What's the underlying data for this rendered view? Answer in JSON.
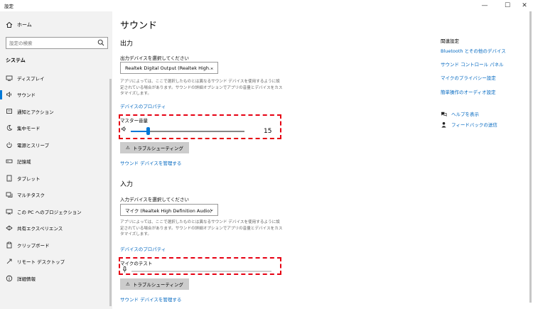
{
  "window": {
    "title": "設定",
    "minimize": "—",
    "maximize": "☐",
    "close": "✕"
  },
  "sidebar": {
    "home": "ホーム",
    "search_placeholder": "設定の検索",
    "section": "システム",
    "items": [
      {
        "label": "ディスプレイ",
        "icon": "display-icon",
        "active": false
      },
      {
        "label": "サウンド",
        "icon": "speaker-icon",
        "active": true
      },
      {
        "label": "通知とアクション",
        "icon": "notification-icon",
        "active": false
      },
      {
        "label": "集中モード",
        "icon": "moon-icon",
        "active": false
      },
      {
        "label": "電源とスリープ",
        "icon": "power-icon",
        "active": false
      },
      {
        "label": "記憶域",
        "icon": "storage-icon",
        "active": false
      },
      {
        "label": "タブレット",
        "icon": "tablet-icon",
        "active": false
      },
      {
        "label": "マルチタスク",
        "icon": "multitask-icon",
        "active": false
      },
      {
        "label": "この PC へのプロジェクション",
        "icon": "projection-icon",
        "active": false
      },
      {
        "label": "共有エクスペリエンス",
        "icon": "shared-icon",
        "active": false
      },
      {
        "label": "クリップボード",
        "icon": "clipboard-icon",
        "active": false
      },
      {
        "label": "リモート デスクトップ",
        "icon": "remote-icon",
        "active": false
      },
      {
        "label": "詳細情報",
        "icon": "info-icon",
        "active": false
      }
    ]
  },
  "main": {
    "title": "サウンド",
    "output": {
      "heading": "出力",
      "select_label": "出力デバイスを選択してください",
      "device": "Realtek Digital Output (Realtek High...",
      "desc": "アプリによっては、ここで選択したものとは異なるサウンド デバイスを使用するように設定されている場合があります。サウンドの詳細オプションでアプリの音量とデバイスをカスタマイズします。",
      "properties_link": "デバイスのプロパティ",
      "master_label": "マスター音量",
      "volume": 15,
      "volume_text": "15",
      "troubleshoot": "トラブルシューティング",
      "manage_link": "サウンド デバイスを管理する"
    },
    "input": {
      "heading": "入力",
      "select_label": "入力デバイスを選択してください",
      "device": "マイク (Realtek High Definition Audio)",
      "desc": "アプリによっては、ここで選択したものとは異なるサウンド デバイスを使用するように設定されている場合があります。サウンドの詳細オプションでアプリの音量とデバイスをカスタマイズします。",
      "properties_link": "デバイスのプロパティ",
      "mic_test_label": "マイクのテスト",
      "troubleshoot": "トラブルシューティング",
      "manage_link": "サウンド デバイスを管理する"
    }
  },
  "related": {
    "title": "関連設定",
    "links": [
      "Bluetooth とその他のデバイス",
      "サウンド コントロール パネル",
      "マイクのプライバシー設定",
      "簡単操作のオーディオ設定"
    ],
    "help": "ヘルプを表示",
    "feedback": "フィードバックの送信"
  },
  "colors": {
    "accent": "#0078d7",
    "link": "#0067c0",
    "highlight": "#e60012"
  }
}
